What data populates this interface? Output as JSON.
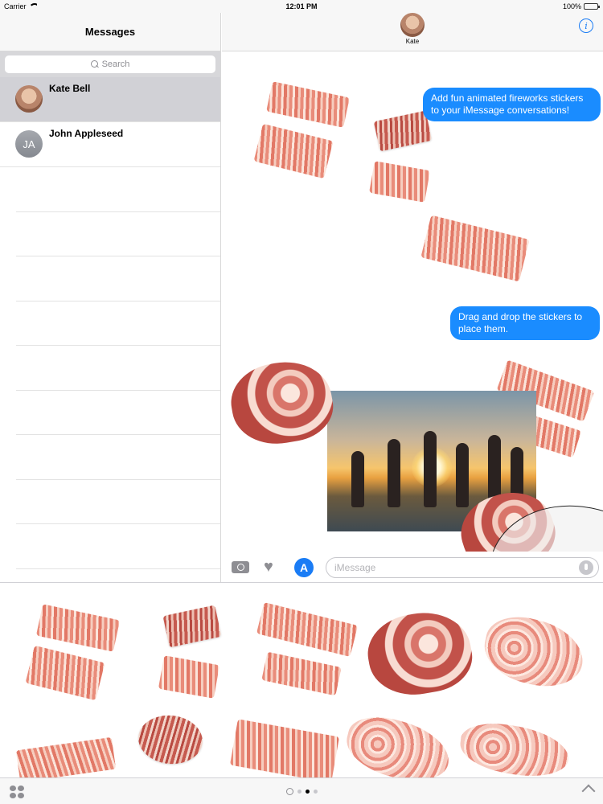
{
  "status_bar": {
    "carrier": "Carrier",
    "time": "12:01 PM",
    "battery": "100%"
  },
  "sidebar": {
    "title": "Messages",
    "search_placeholder": "Search",
    "conversations": [
      {
        "name": "Kate Bell",
        "initials": "",
        "selected": true
      },
      {
        "name": "John Appleseed",
        "initials": "JA",
        "selected": false
      }
    ]
  },
  "conversation": {
    "contact_name": "Kate",
    "messages": [
      "Add fun animated fireworks stickers to your iMessage conversations!",
      "Drag and drop the stickers to place them."
    ],
    "input_placeholder": "iMessage"
  },
  "colors": {
    "bubble": "#1a8cff",
    "accent": "#1a7cf5"
  },
  "icons": [
    "wifi-icon",
    "battery-icon",
    "search-icon",
    "info-icon",
    "camera-icon",
    "digital-touch-icon",
    "app-store-icon",
    "microphone-icon",
    "app-grid-icon",
    "chevron-up-icon"
  ],
  "drawer": {
    "page_count": 3,
    "active_page": 2
  }
}
